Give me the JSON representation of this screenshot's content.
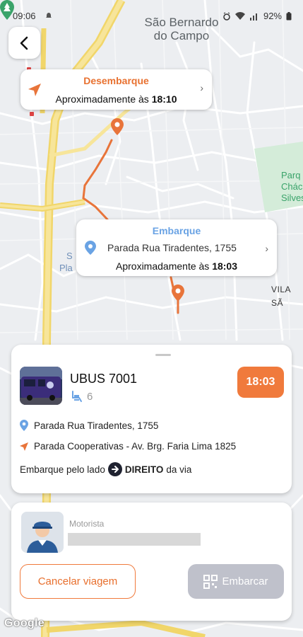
{
  "status_bar": {
    "time": "09:06",
    "battery": "92%"
  },
  "map": {
    "city_label_line1": "São Bernardo",
    "city_label_line2": "do Campo",
    "district_label": "VILA SÃ",
    "park_label_line1": "Parq",
    "park_label_line2": "Chác",
    "park_label_line3": "Silves",
    "left_label_line1": "S",
    "left_label_line2": "Pla",
    "attribution": "Google",
    "route_color": "#e8743a"
  },
  "destination_bubble": {
    "title": "Desembarque",
    "time_prefix": "Aproximadamente às ",
    "time": "18:10"
  },
  "boarding_bubble": {
    "title": "Embarque",
    "stop": "Parada Rua Tiradentes, 1755",
    "time_prefix": "Aproximadamente às ",
    "time": "18:03"
  },
  "trip_card": {
    "bus_name": "UBUS 7001",
    "seat_count": "6",
    "departure_time": "18:03",
    "origin_stop": "Parada Rua Tiradentes, 1755",
    "destination_stop": "Parada Cooperativas - Av. Brg. Faria Lima 1825",
    "boarding_side_prefix": "Embarque pelo lado",
    "boarding_side": "DIREITO",
    "boarding_side_suffix": "da via"
  },
  "driver_card": {
    "label": "Motorista",
    "cancel_label": "Cancelar viagem",
    "board_label": "Embarcar"
  },
  "colors": {
    "accent_orange": "#f07a3c",
    "boarding_blue": "#6aa3e4",
    "disabled_button": "#bfc1cb"
  }
}
